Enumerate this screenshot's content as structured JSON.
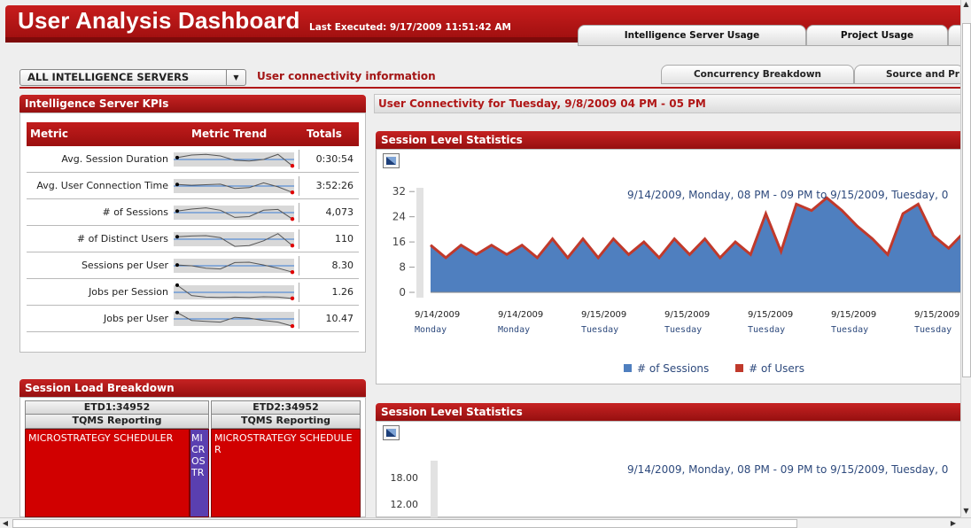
{
  "header": {
    "title": "User Analysis Dashboard",
    "last_executed": "Last Executed: 9/17/2009 11:51:42 AM",
    "tabs": [
      "Intelligence Server Usage",
      "Project Usage"
    ]
  },
  "toolbar": {
    "server_select": "ALL INTELLIGENCE SERVERS",
    "connectivity_label": "User connectivity information",
    "sub_tabs": [
      "Concurrency Breakdown",
      "Source and Pr"
    ]
  },
  "kpi_panel": {
    "title": "Intelligence Server KPIs",
    "columns": [
      "Metric",
      "Metric Trend",
      "Totals"
    ],
    "rows": [
      {
        "metric": "Avg. Session Duration",
        "total": "0:30:54",
        "trend": [
          0.62,
          0.78,
          0.82,
          0.72,
          0.45,
          0.4,
          0.5,
          0.82,
          0.1
        ]
      },
      {
        "metric": "Avg. User Connection Time",
        "total": "3:52:26",
        "trend": [
          0.6,
          0.55,
          0.58,
          0.62,
          0.35,
          0.4,
          0.7,
          0.45,
          0.1
        ]
      },
      {
        "metric": "# of Sessions",
        "total": "4,073",
        "trend": [
          0.6,
          0.72,
          0.8,
          0.65,
          0.2,
          0.25,
          0.65,
          0.7,
          0.1
        ]
      },
      {
        "metric": "# of Distinct Users",
        "total": "110",
        "trend": [
          0.65,
          0.7,
          0.72,
          0.6,
          0.05,
          0.1,
          0.4,
          0.85,
          0.1
        ]
      },
      {
        "metric": "Sessions per User",
        "total": "8.30",
        "trend": [
          0.55,
          0.5,
          0.35,
          0.3,
          0.7,
          0.72,
          0.55,
          0.35,
          0.1
        ]
      },
      {
        "metric": "Jobs per Session",
        "total": "1.26",
        "trend": [
          0.95,
          0.3,
          0.2,
          0.18,
          0.2,
          0.18,
          0.22,
          0.2,
          0.12
        ]
      },
      {
        "metric": "Jobs per User",
        "total": "10.47",
        "trend": [
          0.9,
          0.4,
          0.35,
          0.3,
          0.6,
          0.55,
          0.4,
          0.3,
          0.05
        ]
      }
    ]
  },
  "load_panel": {
    "title": "Session Load Breakdown",
    "servers": [
      {
        "name": "ETD1:34952",
        "project": "TQMS Reporting",
        "tiles": [
          "MICROSTRATEGY SCHEDULER",
          "MICROSTR"
        ]
      },
      {
        "name": "ETD2:34952",
        "project": "TQMS Reporting",
        "tiles": [
          "MICROSTRATEGY SCHEDULER"
        ]
      }
    ]
  },
  "connectivity": {
    "title": "User Connectivity for Tuesday, 9/8/2009 04 PM - 05 PM"
  },
  "chart1_panel": {
    "title": "Session Level Statistics",
    "tooltip": "9/14/2009, Monday, 08 PM - 09 PM to 9/15/2009, Tuesday, 0"
  },
  "chart2_panel": {
    "title": "Session Level Statistics",
    "tooltip": "9/14/2009, Monday, 08 PM - 09 PM to 9/15/2009, Tuesday, 0",
    "y_ticks": [
      "18.00",
      "12.00"
    ]
  },
  "colors": {
    "sessions": "#4f7fbf",
    "users": "#c0392b",
    "brand_red": "#b01818"
  },
  "chart_data": [
    {
      "type": "area",
      "title": "Session Level Statistics",
      "y_ticks": [
        0,
        8,
        16,
        24,
        32
      ],
      "ylim": [
        0,
        36
      ],
      "x_labels": [
        {
          "date": "9/14/2009",
          "day": "Monday"
        },
        {
          "date": "9/14/2009",
          "day": "Monday"
        },
        {
          "date": "9/15/2009",
          "day": "Tuesday"
        },
        {
          "date": "9/15/2009",
          "day": "Tuesday"
        },
        {
          "date": "9/15/2009",
          "day": "Tuesday"
        },
        {
          "date": "9/15/2009",
          "day": "Tuesday"
        },
        {
          "date": "9/15/2009",
          "day": "Tuesday"
        }
      ],
      "series": [
        {
          "name": "# of Sessions",
          "values": [
            15,
            11,
            15,
            12,
            15,
            12,
            15,
            11,
            17,
            11,
            17,
            11,
            17,
            12,
            16,
            11,
            17,
            12,
            17,
            11,
            16,
            12,
            25,
            13,
            28,
            26,
            30,
            26,
            21,
            17,
            12,
            25,
            28,
            18,
            14,
            19
          ]
        },
        {
          "name": "# of Users",
          "values": [
            15,
            11,
            15,
            12,
            15,
            12,
            15,
            11,
            17,
            11,
            17,
            11,
            17,
            12,
            16,
            11,
            17,
            12,
            17,
            11,
            16,
            12,
            25,
            13,
            28,
            26,
            30,
            26,
            21,
            17,
            12,
            25,
            28,
            18,
            14,
            19
          ]
        }
      ],
      "legend": "bottom"
    }
  ]
}
